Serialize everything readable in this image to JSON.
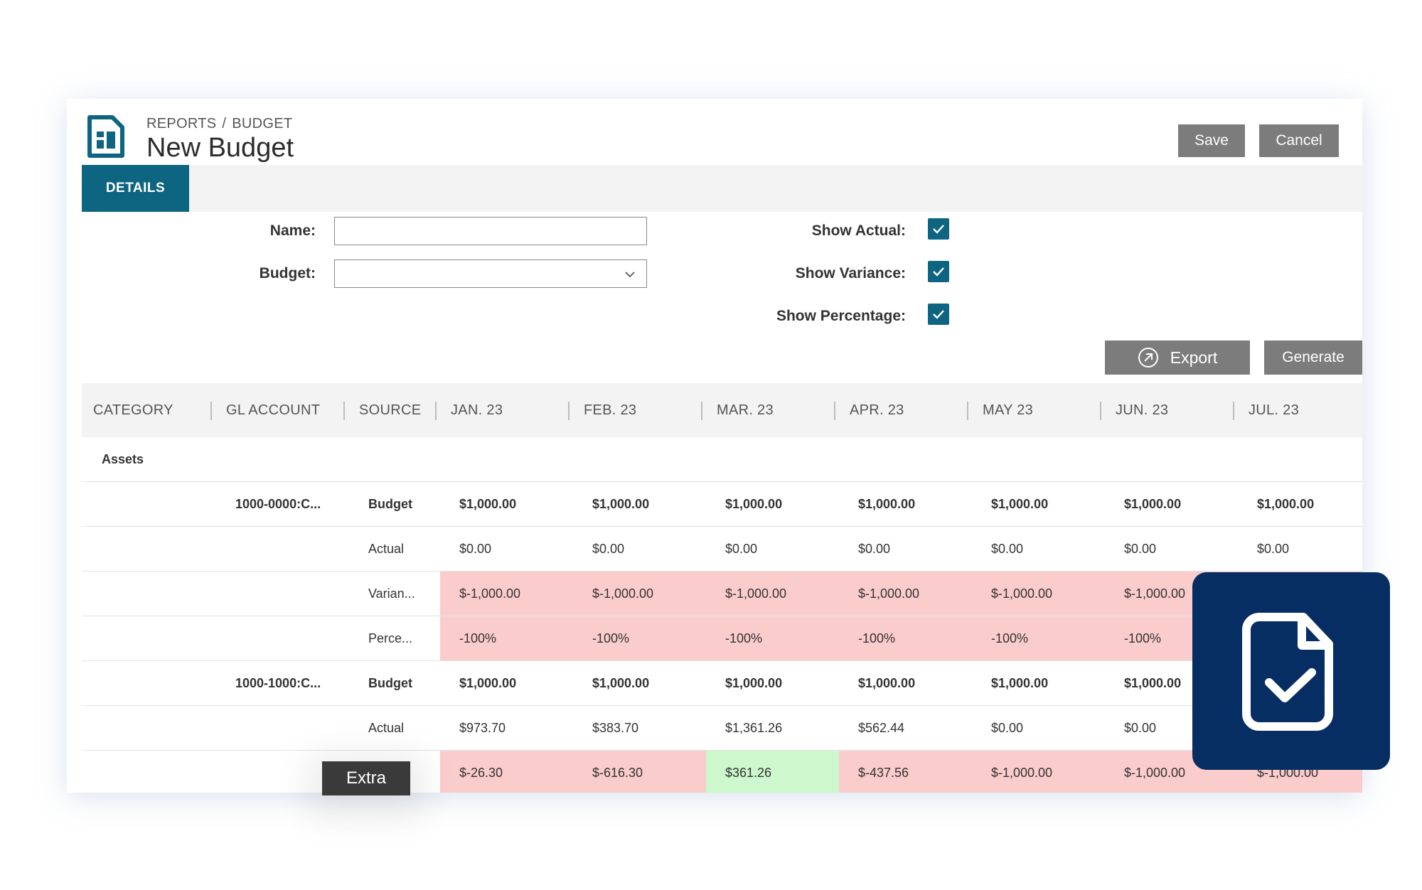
{
  "header": {
    "breadcrumb": [
      "REPORTS",
      "BUDGET"
    ],
    "breadcrumb_sep": "/",
    "title": "New Budget",
    "save_label": "Save",
    "cancel_label": "Cancel"
  },
  "tabs": [
    {
      "label": "DETAILS",
      "active": true
    }
  ],
  "form": {
    "name_label": "Name:",
    "name_value": "",
    "budget_label": "Budget:",
    "budget_value": "",
    "show_actual_label": "Show Actual:",
    "show_actual_checked": true,
    "show_variance_label": "Show Variance:",
    "show_variance_checked": true,
    "show_percentage_label": "Show Percentage:",
    "show_percentage_checked": true
  },
  "actions": {
    "export_label": "Export",
    "generate_label": "Generate"
  },
  "table": {
    "columns": [
      "CATEGORY",
      "GL ACCOUNT",
      "SOURCE",
      "JAN. 23",
      "FEB. 23",
      "MAR. 23",
      "APR. 23",
      "MAY 23",
      "JUN. 23",
      "JUL. 23"
    ],
    "category": "Assets",
    "rows": [
      {
        "account": "1000-0000:C...",
        "source": "Budget",
        "values": [
          "$1,000.00",
          "$1,000.00",
          "$1,000.00",
          "$1,000.00",
          "$1,000.00",
          "$1,000.00",
          "$1,000.00"
        ]
      },
      {
        "account": "",
        "source": "Actual",
        "values": [
          "$0.00",
          "$0.00",
          "$0.00",
          "$0.00",
          "$0.00",
          "$0.00",
          "$0.00"
        ]
      },
      {
        "account": "",
        "source": "Varian...",
        "values": [
          "$-1,000.00",
          "$-1,000.00",
          "$-1,000.00",
          "$-1,000.00",
          "$-1,000.00",
          "$-1,000.00",
          ""
        ]
      },
      {
        "account": "",
        "source": "Perce...",
        "values": [
          "-100%",
          "-100%",
          "-100%",
          "-100%",
          "-100%",
          "-100%",
          ""
        ]
      },
      {
        "account": "1000-1000:C...",
        "source": "Budget",
        "values": [
          "$1,000.00",
          "$1,000.00",
          "$1,000.00",
          "$1,000.00",
          "$1,000.00",
          "$1,000.00",
          ""
        ]
      },
      {
        "account": "",
        "source": "Actual",
        "values": [
          "$973.70",
          "$383.70",
          "$1,361.26",
          "$562.44",
          "$0.00",
          "$0.00",
          ""
        ]
      },
      {
        "account": "",
        "source": "...",
        "values": [
          "$-26.30",
          "$-616.30",
          "$361.26",
          "$-437.56",
          "$-1,000.00",
          "$-1,000.00",
          "$-1,000.00"
        ]
      }
    ]
  },
  "extra_label": "Extra",
  "colors": {
    "accent": "#0e6582",
    "button_gray": "#7c7c7c",
    "negative_highlight": "#fbcccc",
    "positive_highlight": "#cdf7cd",
    "badge_navy": "#062e63"
  },
  "icons": {
    "page": "report-document-icon",
    "dropdown": "chevron-down-icon",
    "checkbox": "checkmark-icon",
    "export": "export-arrow-icon",
    "badge": "document-check-icon"
  }
}
